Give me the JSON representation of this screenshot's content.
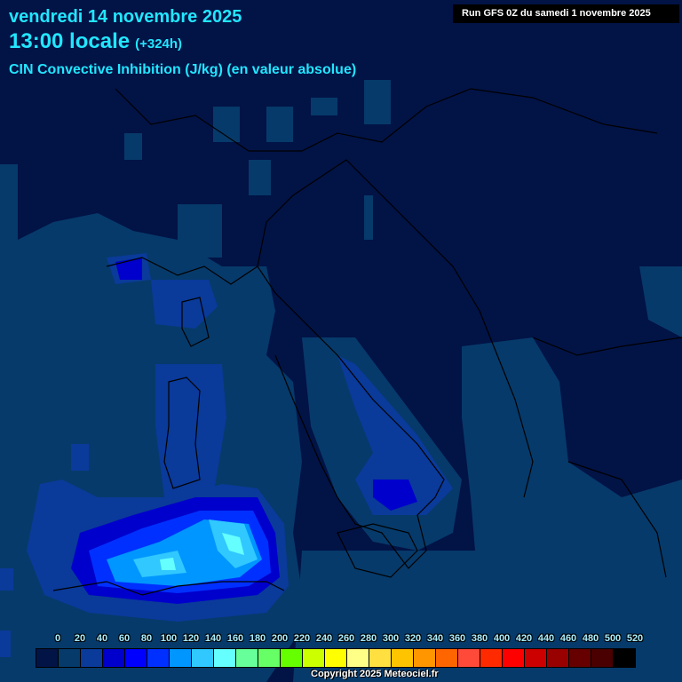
{
  "header": {
    "date": "vendredi 14 novembre 2025",
    "time": "13:00 locale",
    "lead": "(+324h)",
    "parameter": "CIN Convective Inhibition (J/kg) (en valeur absolue)",
    "run": "Run GFS 0Z du samedi 1 novembre 2025"
  },
  "legend": {
    "labels": [
      "0",
      "20",
      "40",
      "60",
      "80",
      "100",
      "120",
      "140",
      "160",
      "180",
      "200",
      "220",
      "240",
      "260",
      "280",
      "300",
      "320",
      "340",
      "360",
      "380",
      "400",
      "420",
      "440",
      "460",
      "480",
      "500",
      "520"
    ],
    "colors": [
      "#021346",
      "#063a6a",
      "#0a3a9a",
      "#0000cc",
      "#0000ff",
      "#0030ff",
      "#0096ff",
      "#30c8ff",
      "#66ffff",
      "#66ff99",
      "#66ff66",
      "#66ff00",
      "#ccff00",
      "#ffff00",
      "#ffff88",
      "#ffe040",
      "#ffc400",
      "#ff9600",
      "#ff6600",
      "#ff4a3a",
      "#ff2a00",
      "#ff0000",
      "#cc0000",
      "#990000",
      "#660000",
      "#4a0000",
      "#000000"
    ]
  },
  "copyright": "Copyright 2025 Meteociel.fr"
}
